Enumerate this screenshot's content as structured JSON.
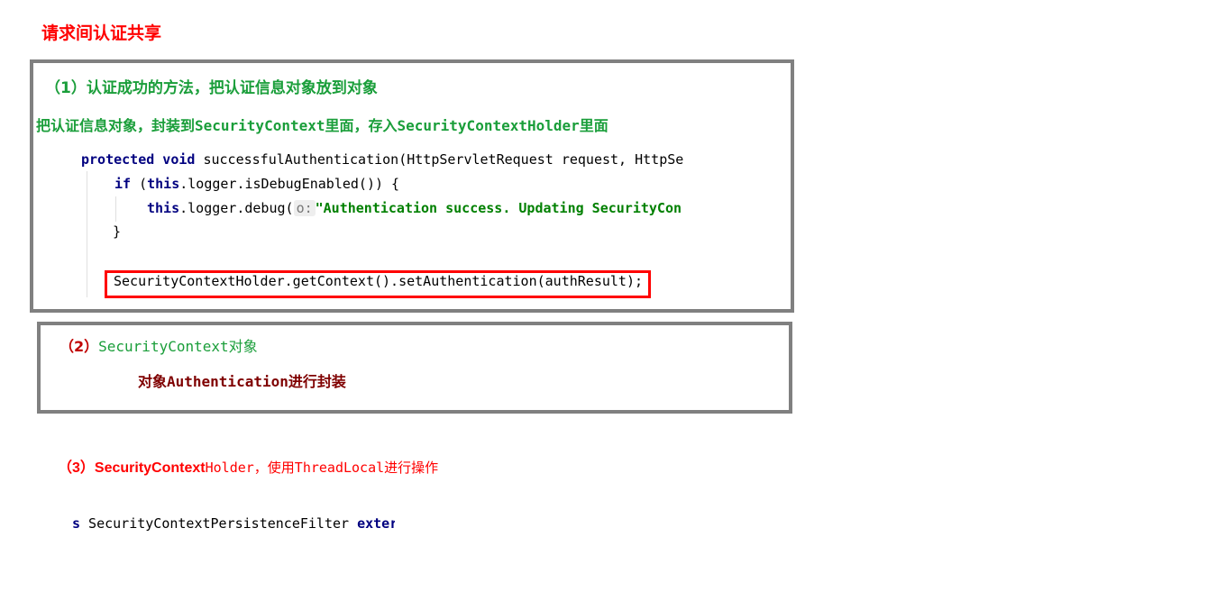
{
  "title": "请求间认证共享",
  "section1": {
    "heading": "（1）认证成功的方法，把认证信息对象放到对象",
    "description": "把认证信息对象，封装到SecurityContext里面，存入SecurityContextHolder里面",
    "code": {
      "line1_kw": "protected void",
      "line1_rest": " successfulAuthentication(HttpServletRequest request, HttpSer",
      "line2_kw1": "if",
      "line2_a": " (",
      "line2_kw2": "this",
      "line2_rest": ".logger.isDebugEnabled()) {",
      "line3_kw": "this",
      "line3_rest": ".logger.debug(",
      "line3_hint": "o:",
      "line3_str": "\"Authentication success. Updating SecurityCon",
      "line4": "}",
      "highlight": "SecurityContextHolder.getContext().setAuthentication(authResult);"
    }
  },
  "section2": {
    "heading_prefix": "（2）",
    "heading": "SecurityContext对象",
    "description": "对象Authentication进行封装"
  },
  "section3": {
    "heading_bold": "（3）SecurityContext",
    "heading_rest": "Holder，使用ThreadLocal进行操作",
    "code_kw": "s",
    "code_name": " SecurityContextPersistenceFilter ",
    "code_kw2": "exter"
  }
}
